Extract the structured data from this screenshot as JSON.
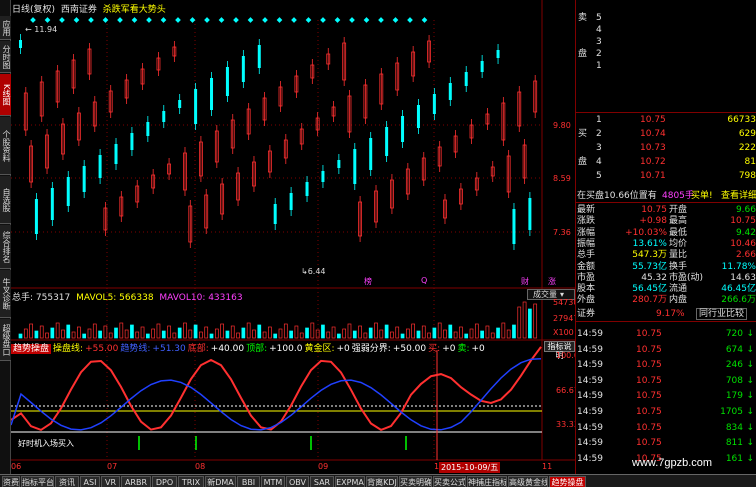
{
  "sidebar": {
    "tabs": [
      {
        "label": "应用",
        "active": false
      },
      {
        "label": "分时图",
        "active": false
      },
      {
        "label": "K线图",
        "active": true
      },
      {
        "label": "个股资料",
        "active": false
      },
      {
        "label": "自选股",
        "active": false
      },
      {
        "label": "综合排名",
        "active": false
      },
      {
        "label": "牛叉诊断",
        "active": false
      },
      {
        "label": "超级盘口",
        "active": false
      }
    ]
  },
  "header": {
    "period": "日线(复权)",
    "broker": "西南证券",
    "slogan": "杀跌军看大势头",
    "high_marker": "11.94",
    "low_marker": "6.44",
    "price_ticks": [
      "9.80",
      "8.59",
      "7.36"
    ],
    "event_marks": [
      "榜",
      "Q",
      "财",
      "涨"
    ]
  },
  "volume_panel": {
    "total_label": "总手: 755317",
    "mavol5": "MAVOL5: 566338",
    "mavol10": "MAVOL10: 433163",
    "dropdown": "成交量",
    "ticks": [
      "54730",
      "27947",
      "X100"
    ]
  },
  "indicator_panel": {
    "items": [
      {
        "label": "趋势操盘",
        "color": "#ffffff",
        "bg": "#c00000"
      },
      {
        "label": "操盘线:",
        "color": "#ffff00",
        "bg": ""
      },
      {
        "label": "+55.00",
        "color": "#ff3030",
        "bg": ""
      },
      {
        "label": "趋势线:",
        "color": "#4060ff",
        "bg": ""
      },
      {
        "label": "+51.30",
        "color": "#4060ff",
        "bg": ""
      },
      {
        "label": "底部:",
        "color": "#ff3030",
        "bg": ""
      },
      {
        "label": "+40.00",
        "color": "#ffffff",
        "bg": ""
      },
      {
        "label": "顶部:",
        "color": "#00ff00",
        "bg": ""
      },
      {
        "label": "+100.0",
        "color": "#ffffff",
        "bg": ""
      },
      {
        "label": "黄金区:",
        "color": "#ffff00",
        "bg": ""
      },
      {
        "label": "+0",
        "color": "#ffffff",
        "bg": ""
      },
      {
        "label": "强弱分界:",
        "color": "#ffffff",
        "bg": ""
      },
      {
        "label": "+50.00",
        "color": "#ffffff",
        "bg": ""
      },
      {
        "label": "买:",
        "color": "#ff3030",
        "bg": ""
      },
      {
        "label": "+0",
        "color": "#ffffff",
        "bg": ""
      },
      {
        "label": "卖:",
        "color": "#00ff00",
        "bg": ""
      },
      {
        "label": "+0",
        "color": "#ffffff",
        "bg": ""
      }
    ],
    "help_button": "指标说明",
    "ticks": [
      "100.0",
      "66.67",
      "33.33"
    ],
    "annotation": "好时机入场买入"
  },
  "time_axis": {
    "labels": [
      "06",
      "07",
      "08",
      "09",
      "10",
      "11"
    ],
    "cursor_date": "2015-10-09/五"
  },
  "order_book": {
    "sell": [
      {
        "label": "卖",
        "lvl": "5",
        "price": "",
        "vol": ""
      },
      {
        "label": "",
        "lvl": "4",
        "price": "",
        "vol": ""
      },
      {
        "label": "",
        "lvl": "3",
        "price": "",
        "vol": ""
      },
      {
        "label": "盘",
        "lvl": "2",
        "price": "",
        "vol": ""
      },
      {
        "label": "",
        "lvl": "1",
        "price": "",
        "vol": ""
      }
    ],
    "buy": [
      {
        "label": "",
        "lvl": "1",
        "price": "10.75",
        "vol": "66733"
      },
      {
        "label": "买",
        "lvl": "2",
        "price": "10.74",
        "vol": "629"
      },
      {
        "label": "",
        "lvl": "3",
        "price": "10.73",
        "vol": "222"
      },
      {
        "label": "盘",
        "lvl": "4",
        "price": "10.72",
        "vol": "81"
      },
      {
        "label": "",
        "lvl": "5",
        "price": "10.71",
        "vol": "798"
      }
    ],
    "notice_left": "在买盘10.66位置有",
    "notice_qty": "4805手",
    "notice_buy": "买单!",
    "notice_link": "查看详细"
  },
  "quote": {
    "rows": [
      {
        "k1": "最新",
        "v1": "10.75",
        "c1": "red",
        "k2": "开盘",
        "v2": "9.66",
        "c2": "green"
      },
      {
        "k1": "涨跌",
        "v1": "+0.98",
        "c1": "red",
        "k2": "最高",
        "v2": "10.75",
        "c2": "red"
      },
      {
        "k1": "涨幅",
        "v1": "+10.03%",
        "c1": "red",
        "k2": "最低",
        "v2": "9.42",
        "c2": "green"
      },
      {
        "k1": "振幅",
        "v1": "13.61%",
        "c1": "cyan",
        "k2": "均价",
        "v2": "10.46",
        "c2": "red"
      },
      {
        "k1": "总手",
        "v1": "547.3万",
        "c1": "yellow",
        "k2": "量比",
        "v2": "2.66",
        "c2": "red"
      },
      {
        "k1": "金额",
        "v1": "55.73亿",
        "c1": "cyan",
        "k2": "换手",
        "v2": "11.78%",
        "c2": "cyan"
      },
      {
        "k1": "市盈",
        "v1": "45.32",
        "c1": "white",
        "k2": "市盈(动)",
        "v2": "14.63",
        "c2": "white"
      },
      {
        "k1": "股本",
        "v1": "56.45亿",
        "c1": "cyan",
        "k2": "流通",
        "v2": "46.45亿",
        "c2": "cyan"
      },
      {
        "k1": "外盘",
        "v1": "280.7万",
        "c1": "red",
        "k2": "内盘",
        "v2": "266.6万",
        "c2": "green"
      }
    ],
    "sector_label": "证券",
    "sector_change": "9.17%",
    "compare_button": "同行业比较"
  },
  "ticks": [
    {
      "time": "14:59",
      "price": "10.75",
      "vol": "720",
      "dir": "down"
    },
    {
      "time": "14:59",
      "price": "10.75",
      "vol": "674",
      "dir": "down"
    },
    {
      "time": "14:59",
      "price": "10.75",
      "vol": "246",
      "dir": "down"
    },
    {
      "time": "14:59",
      "price": "10.75",
      "vol": "708",
      "dir": "down"
    },
    {
      "time": "14:59",
      "price": "10.75",
      "vol": "179",
      "dir": "down"
    },
    {
      "time": "14:59",
      "price": "10.75",
      "vol": "1705",
      "dir": "down"
    },
    {
      "time": "14:59",
      "price": "10.75",
      "vol": "834",
      "dir": "down"
    },
    {
      "time": "14:59",
      "price": "10.75",
      "vol": "811",
      "dir": "down"
    },
    {
      "time": "14:59",
      "price": "10.75",
      "vol": "161",
      "dir": "down"
    }
  ],
  "bottom_tabs": [
    {
      "label": "资费",
      "active": false
    },
    {
      "label": "指标平台",
      "active": false
    },
    {
      "label": "资讯",
      "active": false
    },
    {
      "label": "ASI",
      "active": false
    },
    {
      "label": "VR",
      "active": false
    },
    {
      "label": "ARBR",
      "active": false
    },
    {
      "label": "DPO",
      "active": false
    },
    {
      "label": "TRIX",
      "active": false
    },
    {
      "label": "新DMA",
      "active": false
    },
    {
      "label": "BBI",
      "active": false
    },
    {
      "label": "MTM",
      "active": false
    },
    {
      "label": "OBV",
      "active": false
    },
    {
      "label": "SAR",
      "active": false
    },
    {
      "label": "EXPMA",
      "active": false
    },
    {
      "label": "背离KDJ",
      "active": false
    },
    {
      "label": "买卖明确",
      "active": false
    },
    {
      "label": "买卖公式",
      "active": false
    },
    {
      "label": "神捕庄指标",
      "active": false
    },
    {
      "label": "高级黄金线",
      "active": false
    },
    {
      "label": "趋势操盘",
      "active": true
    }
  ],
  "watermark": "www.7gpzb.com",
  "colors": {
    "up": "#ff3030",
    "down": "#00ffff",
    "grid": "#800000",
    "bg": "#000000"
  }
}
